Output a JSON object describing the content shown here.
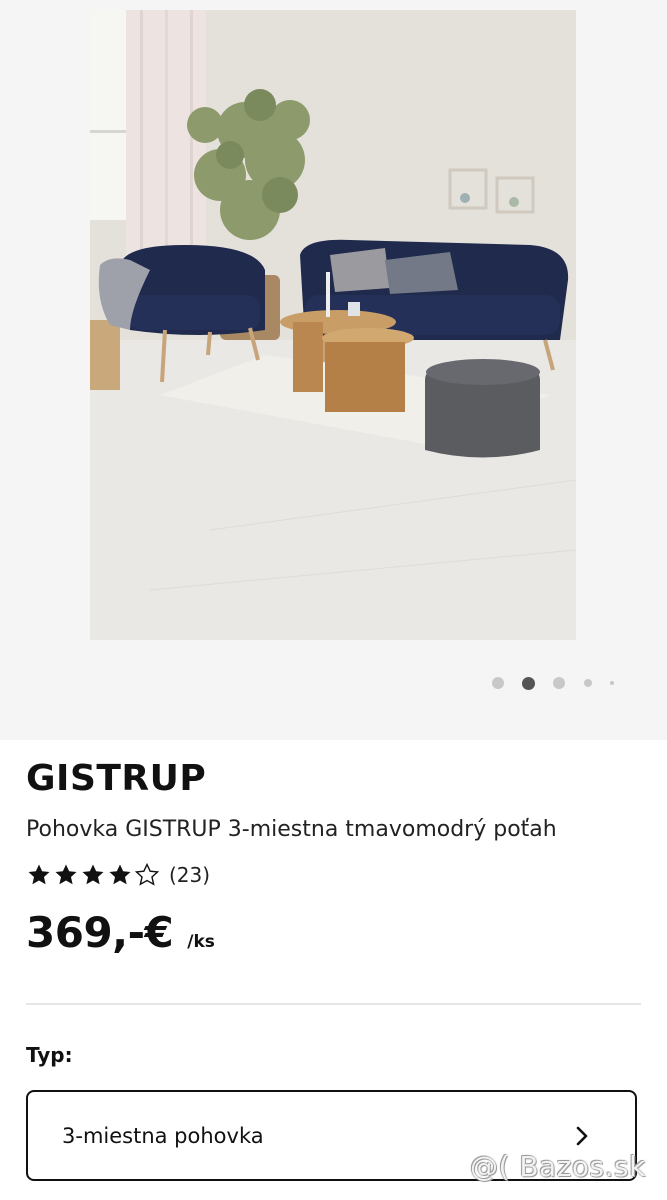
{
  "gallery": {
    "image_alt": "Pohovka GISTRUP v obývačke",
    "dots_count": 5,
    "active_dot": 1
  },
  "product": {
    "brand": "GISTRUP",
    "description": "Pohovka GISTRUP 3-miestna tmavomodrý poťah",
    "rating": {
      "stars": 4,
      "max": 5,
      "count": "(23)"
    },
    "price": {
      "value": "369,-€",
      "unit": "/ks"
    }
  },
  "type_section": {
    "label": "Typ:",
    "selected": "3-miestna pohovka"
  },
  "watermark": "@( Bazos.sk",
  "colors": {
    "sofa": "#1f2a4d",
    "text": "#111111",
    "divider": "#e6e6e6",
    "dot_active": "#555555",
    "dot_inactive": "#c8c8c8"
  }
}
